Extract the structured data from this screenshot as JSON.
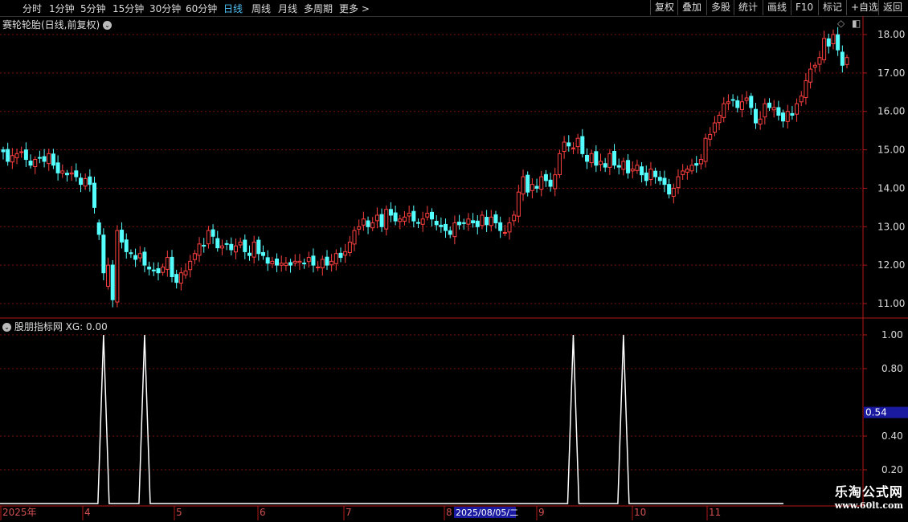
{
  "toolbar": {
    "periods": [
      "分时",
      "1分钟",
      "5分钟",
      "15分钟",
      "30分钟",
      "60分钟",
      "日线",
      "周线",
      "月线",
      "多周期",
      "更多 >"
    ],
    "active": "日线",
    "buttons": [
      "复权",
      "叠加",
      "多股",
      "统计",
      "画线",
      "F10",
      "标记",
      "+自选",
      "返回"
    ]
  },
  "main_title": "赛轮轮胎(日线,前复权)",
  "indicator_title": "股朋指标网 XG: 0.00",
  "price_axis": [
    "18.00",
    "17.00",
    "16.00",
    "15.00",
    "14.00",
    "13.00",
    "12.00",
    "11.00"
  ],
  "indicator_axis": [
    "1.00",
    "0.80",
    "0.54",
    "0.40",
    "0.20"
  ],
  "indicator_cursor_value": "0.54",
  "time_axis": [
    "2025年",
    "4",
    "5",
    "6",
    "7",
    "8",
    "9",
    "10",
    "11"
  ],
  "time_cursor": "2025/08/05/二",
  "watermark": {
    "line1": "乐淘公式网",
    "line2": "www.60lt.com"
  },
  "colors": {
    "up": "#ff4040",
    "down": "#54ffff",
    "grid": "#7a1010",
    "axis": "#b01818",
    "signal": "#ffffff"
  },
  "chart_data": [
    {
      "type": "candlestick",
      "title": "赛轮轮胎(日线,前复权)",
      "ylim": [
        10.8,
        18.3
      ],
      "closes": [
        14.95,
        14.7,
        14.85,
        14.9,
        14.95,
        14.75,
        14.6,
        14.75,
        14.8,
        14.7,
        14.9,
        14.6,
        14.4,
        14.45,
        14.35,
        14.4,
        14.3,
        14.1,
        14.25,
        14.1,
        13.5,
        12.8,
        11.8,
        12.0,
        11.1,
        12.9,
        12.6,
        12.35,
        12.3,
        12.15,
        12.3,
        12.0,
        11.9,
        11.85,
        11.8,
        11.95,
        12.2,
        11.7,
        11.55,
        11.8,
        11.85,
        12.1,
        12.3,
        12.55,
        12.5,
        12.9,
        12.75,
        12.45,
        12.5,
        12.55,
        12.4,
        12.5,
        12.6,
        12.35,
        12.25,
        12.6,
        12.3,
        12.25,
        12.05,
        12.1,
        12.0,
        12.05,
        12.05,
        12.0,
        12.1,
        12.1,
        12.05,
        12.2,
        12.0,
        11.95,
        12.15,
        12.0,
        12.1,
        12.3,
        12.2,
        12.35,
        12.6,
        12.9,
        13.0,
        13.2,
        13.0,
        13.1,
        13.3,
        13.0,
        13.45,
        13.3,
        13.15,
        13.2,
        13.25,
        13.35,
        13.15,
        13.1,
        13.2,
        13.35,
        13.2,
        13.05,
        13.0,
        12.9,
        12.8,
        13.1,
        13.05,
        13.1,
        13.2,
        13.1,
        13.0,
        13.3,
        13.05,
        13.25,
        13.1,
        12.9,
        12.85,
        13.1,
        13.3,
        13.9,
        14.3,
        13.9,
        14.1,
        14.0,
        14.3,
        14.2,
        14.05,
        14.35,
        14.9,
        15.2,
        15.1,
        15.05,
        15.3,
        14.9,
        14.7,
        14.9,
        14.6,
        14.7,
        14.55,
        14.9,
        14.6,
        14.55,
        14.7,
        14.4,
        14.5,
        14.6,
        14.35,
        14.2,
        14.5,
        14.3,
        14.2,
        14.1,
        13.85,
        14.0,
        14.3,
        14.45,
        14.5,
        14.6,
        14.6,
        14.75,
        15.3,
        15.4,
        15.7,
        15.9,
        16.2,
        16.25,
        16.3,
        16.1,
        16.25,
        16.35,
        16.1,
        15.7,
        15.8,
        16.2,
        16.1,
        16.1,
        15.9,
        15.75,
        16.0,
        15.9,
        16.2,
        16.4,
        16.8,
        17.1,
        17.2,
        17.4,
        17.9,
        17.7,
        18.0,
        17.6,
        17.2,
        17.4
      ]
    },
    {
      "type": "line",
      "title": "股朋指标网",
      "series": [
        {
          "name": "XG",
          "signal_indices": [
            22,
            31,
            125,
            136
          ]
        }
      ],
      "ylim": [
        0,
        1.05
      ],
      "current_value": 0.0
    }
  ]
}
